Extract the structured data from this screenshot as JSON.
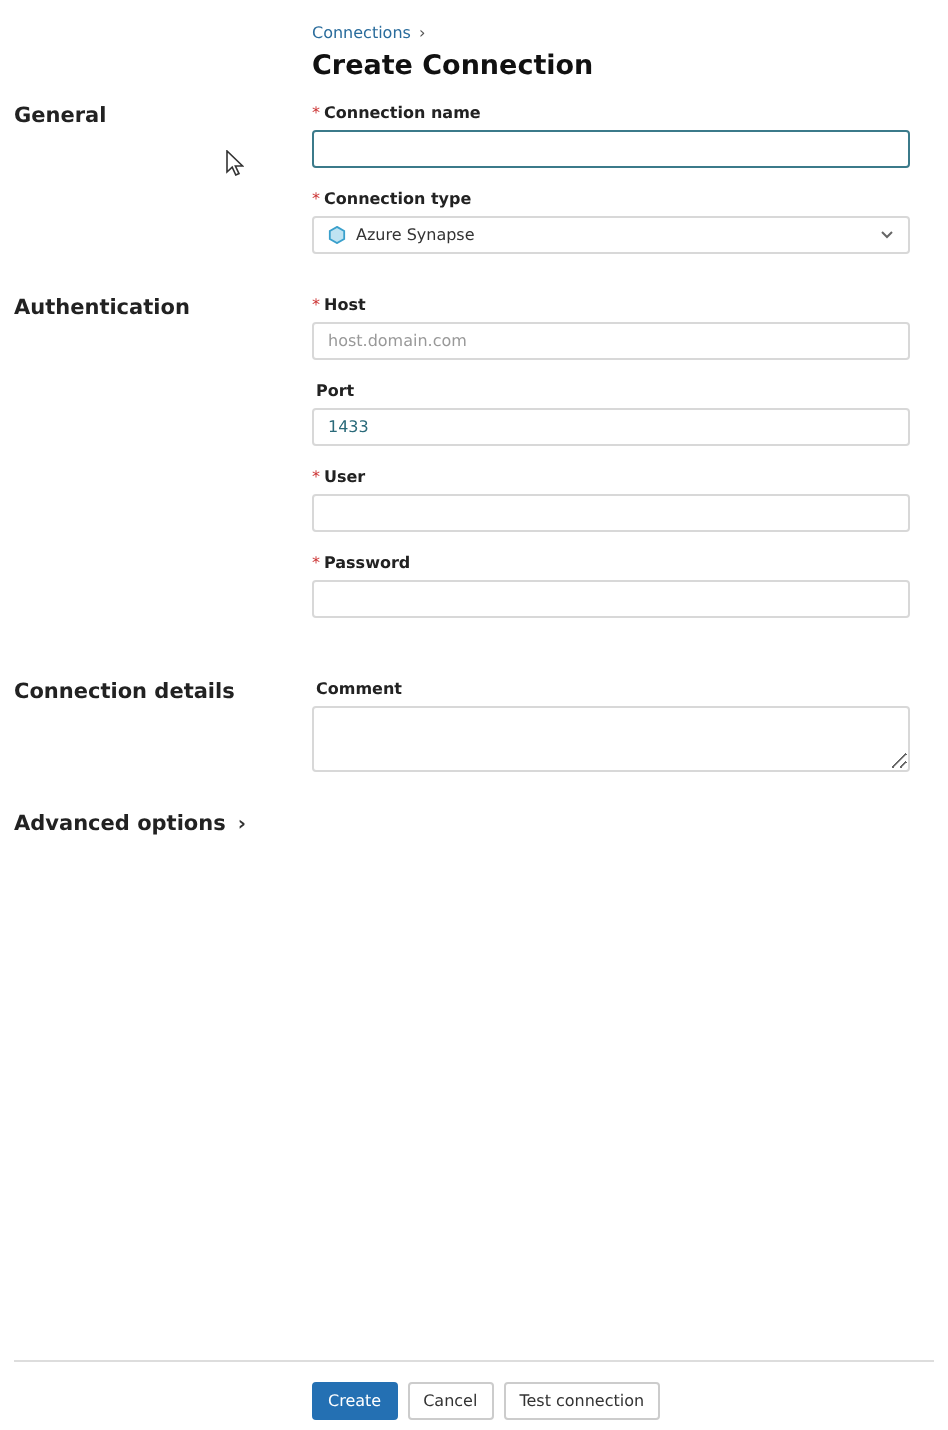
{
  "breadcrumb": {
    "link": "Connections",
    "separator": "›"
  },
  "title": "Create Connection",
  "sections": [
    {
      "title": "General",
      "fields": [
        {
          "kind": "text",
          "label": "Connection name",
          "required_mark": "*",
          "focused": true
        },
        {
          "kind": "select",
          "label": "Connection type",
          "required_mark": "*",
          "value": "Azure Synapse"
        }
      ]
    },
    {
      "title": "Authentication",
      "fields": [
        {
          "kind": "text",
          "label": "Host",
          "required_mark": "*",
          "placeholder": "host.domain.com"
        },
        {
          "kind": "text",
          "label": "Port",
          "value": "1433"
        },
        {
          "kind": "text",
          "label": "User",
          "required_mark": "*"
        },
        {
          "kind": "text",
          "label": "Password",
          "required_mark": "*"
        }
      ]
    },
    {
      "title": "Connection details",
      "fields": [
        {
          "kind": "textarea",
          "label": "Comment"
        }
      ]
    }
  ],
  "advanced": {
    "label": "Advanced options",
    "chevron": "›"
  },
  "buttons": [
    {
      "label": "Create",
      "kind": "primary"
    },
    {
      "label": "Cancel",
      "kind": "default"
    },
    {
      "label": "Test connection",
      "kind": "default"
    }
  ]
}
